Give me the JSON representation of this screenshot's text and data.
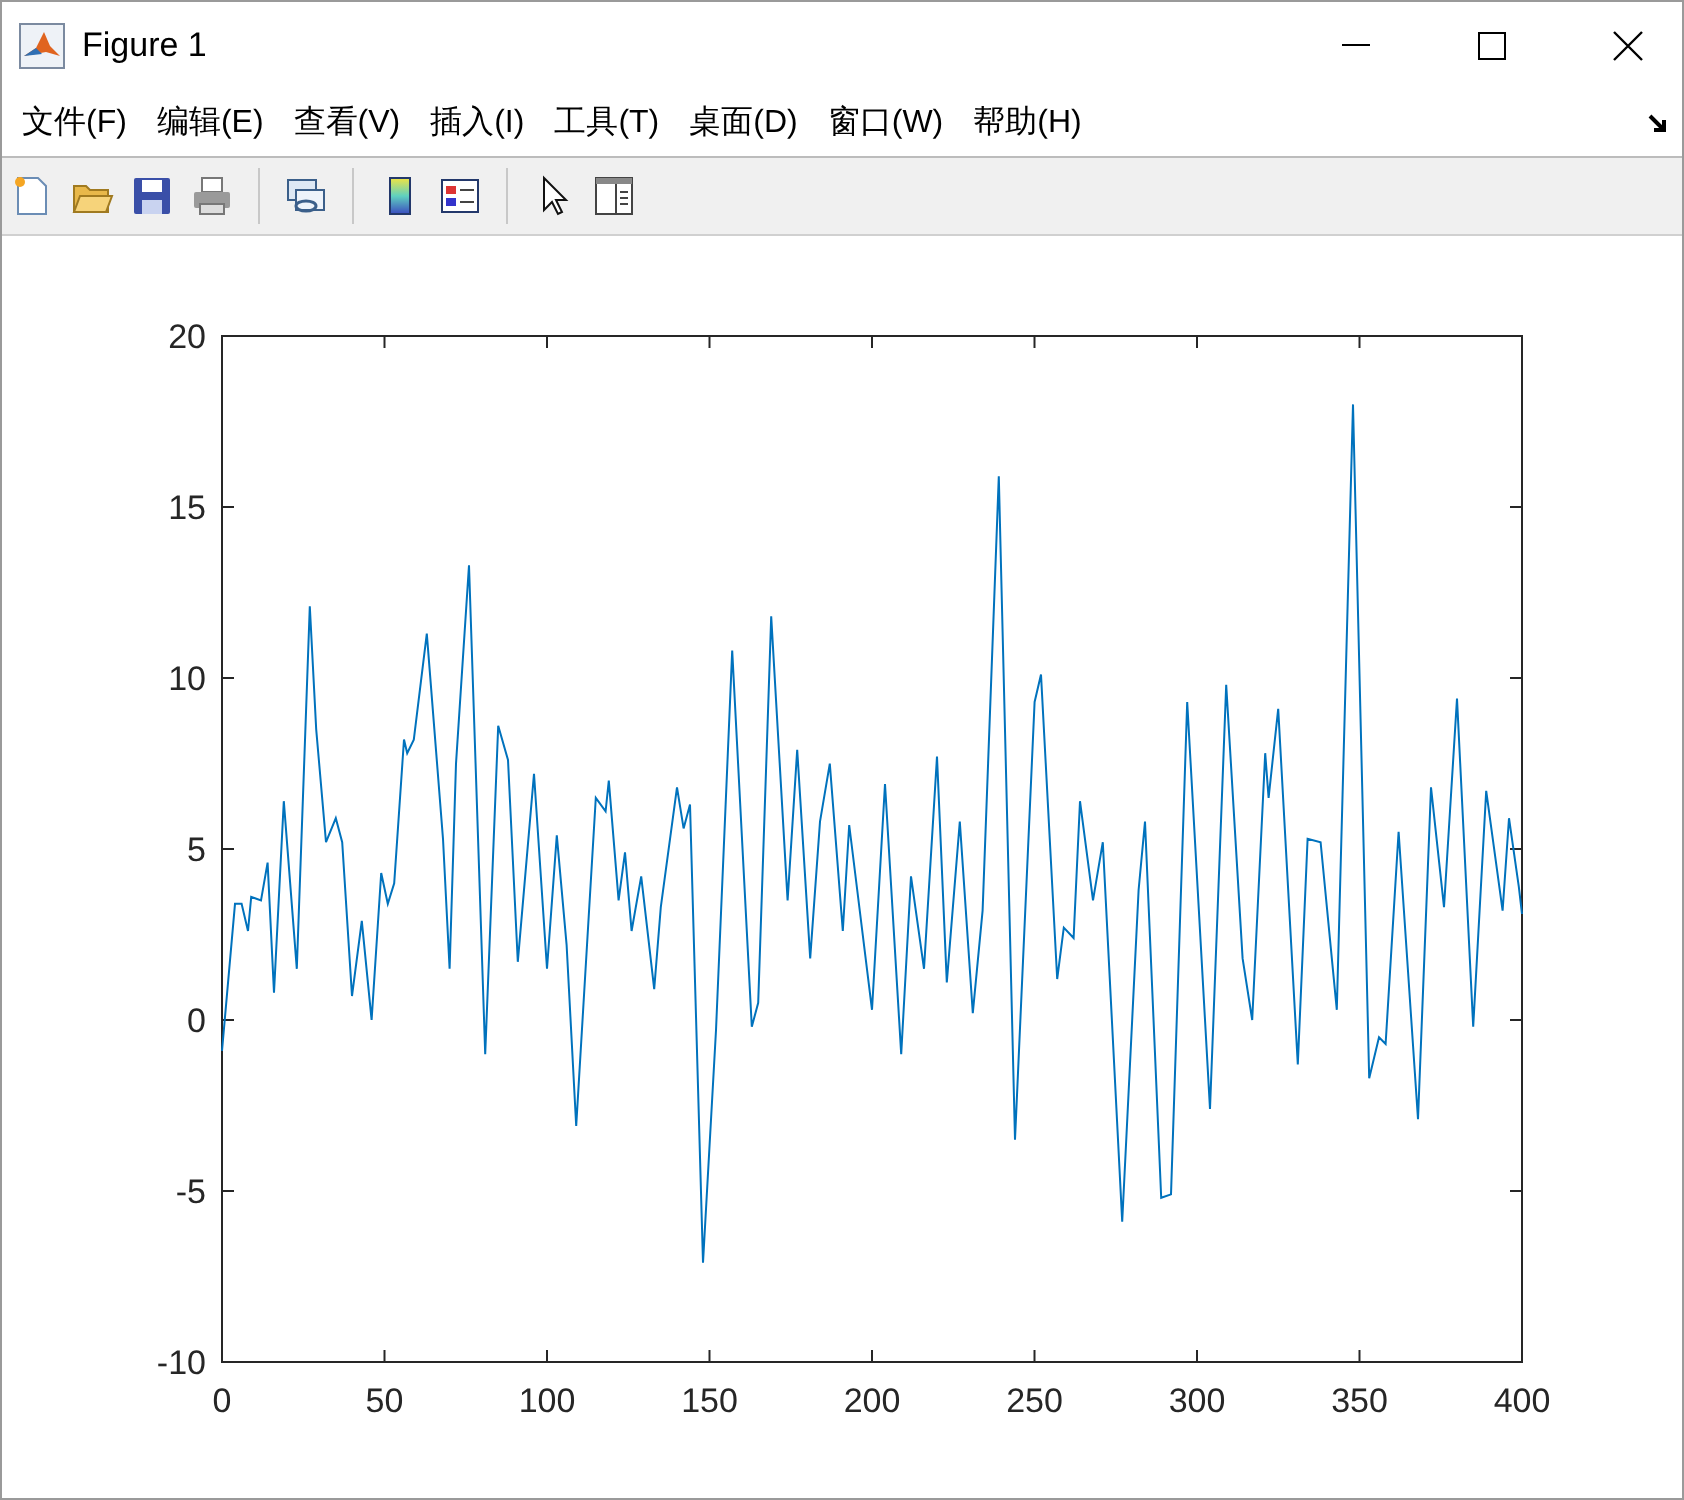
{
  "window": {
    "title": "Figure 1"
  },
  "menu": [
    {
      "label": "文件(F)"
    },
    {
      "label": "编辑(E)"
    },
    {
      "label": "查看(V)"
    },
    {
      "label": "插入(I)"
    },
    {
      "label": "工具(T)"
    },
    {
      "label": "桌面(D)"
    },
    {
      "label": "窗口(W)"
    },
    {
      "label": "帮助(H)"
    }
  ],
  "toolbar": [
    {
      "kind": "new"
    },
    {
      "kind": "open"
    },
    {
      "kind": "save"
    },
    {
      "kind": "print"
    },
    {
      "kind": "separator"
    },
    {
      "kind": "link"
    },
    {
      "kind": "separator"
    },
    {
      "kind": "colorbar"
    },
    {
      "kind": "legend"
    },
    {
      "kind": "separator"
    },
    {
      "kind": "pointer"
    },
    {
      "kind": "inspector"
    }
  ],
  "axes": {
    "chart_data": {
      "type": "line",
      "xlim": [
        0,
        400
      ],
      "ylim": [
        -10,
        20
      ],
      "xticks": [
        0,
        50,
        100,
        150,
        200,
        250,
        300,
        350,
        400
      ],
      "yticks": [
        -10,
        -5,
        0,
        5,
        10,
        15,
        20
      ],
      "x": [
        0,
        4,
        6,
        8,
        9,
        12,
        14,
        16,
        19,
        23,
        27,
        29,
        32,
        35,
        37,
        40,
        43,
        46,
        49,
        51,
        53,
        56,
        57,
        59,
        63,
        68,
        70,
        72,
        76,
        81,
        85,
        88,
        91,
        96,
        100,
        103,
        106,
        109,
        115,
        118,
        119,
        122,
        124,
        126,
        129,
        133,
        135,
        140,
        142,
        144,
        148,
        152,
        157,
        163,
        165,
        169,
        174,
        177,
        181,
        184,
        187,
        191,
        193,
        200,
        204,
        209,
        212,
        216,
        220,
        223,
        227,
        231,
        234,
        239,
        244,
        250,
        252,
        257,
        259,
        262,
        264,
        268,
        271,
        277,
        282,
        284,
        289,
        292,
        297,
        304,
        309,
        314,
        317,
        321,
        322,
        325,
        331,
        334,
        338,
        343,
        348,
        353,
        356,
        358,
        362,
        368,
        372,
        376,
        380,
        385,
        389,
        394,
        396,
        399,
        400
      ],
      "series": [
        {
          "color": "#0072bd",
          "values": [
            -0.9,
            3.4,
            3.4,
            2.6,
            3.6,
            3.5,
            4.6,
            0.8,
            6.4,
            1.5,
            12.1,
            8.5,
            5.2,
            5.9,
            5.2,
            0.7,
            2.9,
            0.0,
            4.3,
            3.4,
            4.0,
            8.2,
            7.8,
            8.2,
            11.3,
            5.3,
            1.5,
            7.5,
            13.3,
            -1.0,
            8.6,
            7.6,
            1.7,
            7.2,
            1.5,
            5.4,
            2.2,
            -3.1,
            6.5,
            6.1,
            7.0,
            3.5,
            4.9,
            2.6,
            4.2,
            0.9,
            3.3,
            6.8,
            5.6,
            6.3,
            -7.1,
            -0.3,
            10.8,
            -0.2,
            0.5,
            11.8,
            3.5,
            7.9,
            1.8,
            5.8,
            7.5,
            2.6,
            5.7,
            0.3,
            6.9,
            -1.0,
            4.2,
            1.5,
            7.7,
            1.1,
            5.8,
            0.2,
            3.2,
            15.9,
            -3.5,
            9.3,
            10.1,
            1.2,
            2.7,
            2.4,
            6.4,
            3.5,
            5.2,
            -5.9,
            3.8,
            5.8,
            -5.2,
            -5.1,
            9.3,
            -2.6,
            9.8,
            1.8,
            0.0,
            7.8,
            6.5,
            9.1,
            -1.3,
            5.3,
            5.2,
            0.3,
            18.0,
            -1.7,
            -0.5,
            -0.7,
            5.5,
            -2.9,
            6.8,
            3.3,
            9.4,
            -0.2,
            6.7,
            3.2,
            5.9,
            3.9,
            3.1
          ]
        }
      ]
    }
  }
}
